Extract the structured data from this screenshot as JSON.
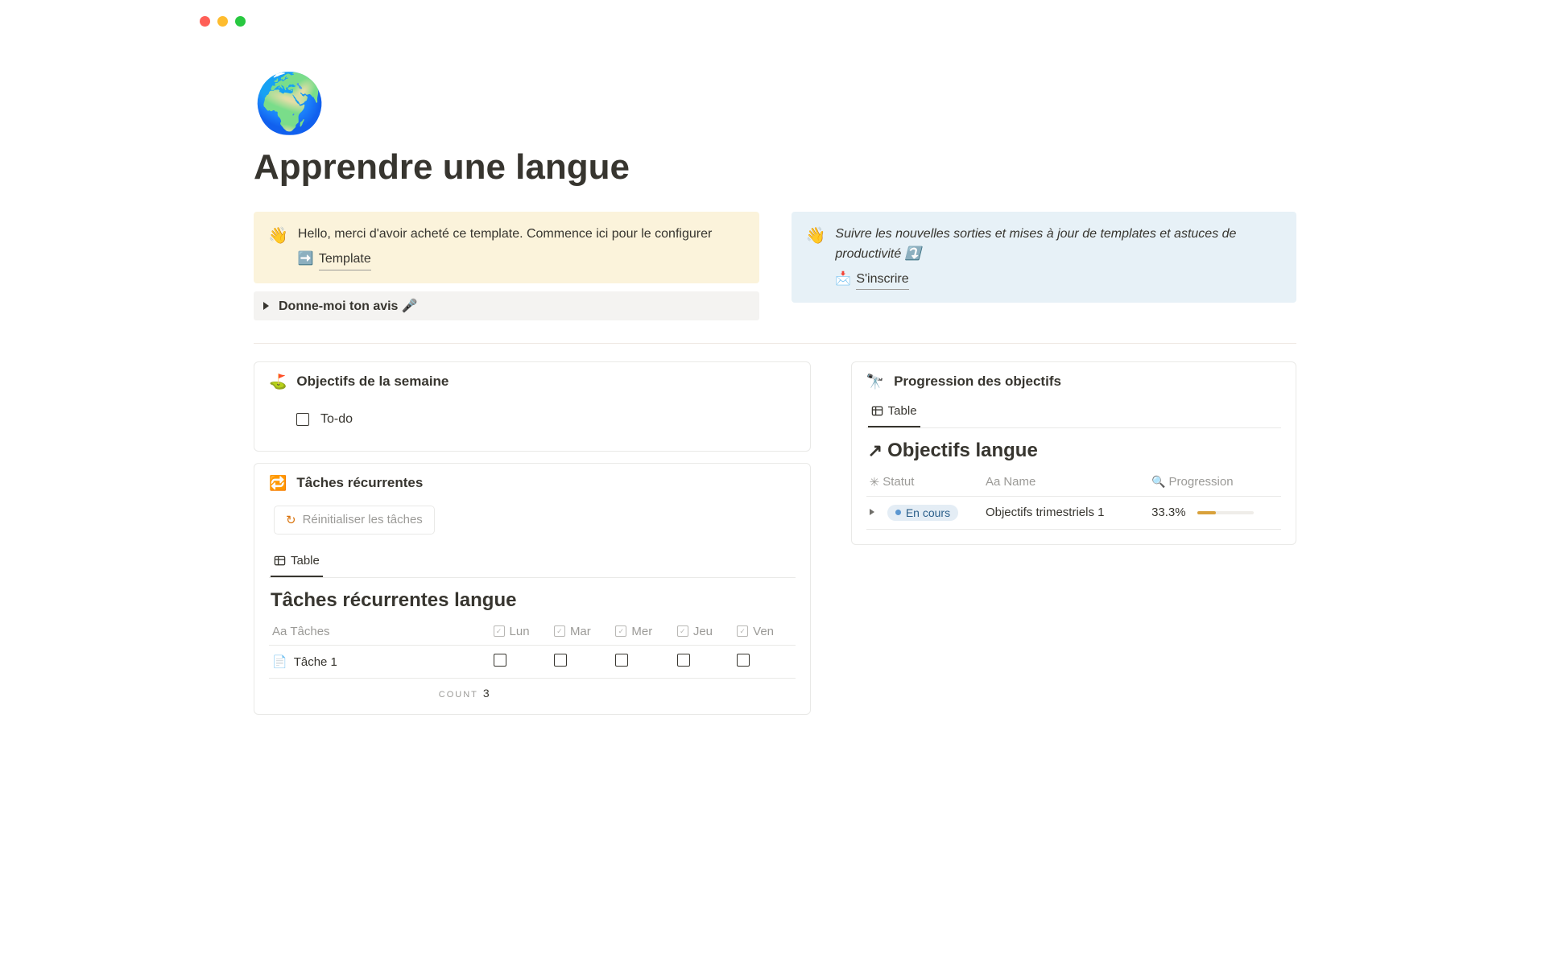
{
  "page": {
    "title": "Apprendre une langue",
    "icon": "🌍"
  },
  "callout_left": {
    "emoji": "👋",
    "text": "Hello, merci d'avoir acheté ce template. Commence ici pour le configurer",
    "link_icon": "➡️",
    "link_text": "Template"
  },
  "callout_right": {
    "emoji": "👋",
    "text": "Suivre les nouvelles sorties et mises à jour de templates et astuces de productivité ⤵️",
    "link_icon": "📩",
    "link_text": "S'inscrire"
  },
  "toggle": {
    "label": "Donne-moi ton avis 🎤"
  },
  "weekly": {
    "icon": "⛳",
    "title": "Objectifs de la semaine",
    "todo_label": "To-do"
  },
  "recurring": {
    "icon": "🔁",
    "title": "Tâches récurrentes",
    "reset_label": "Réinitialiser les tâches",
    "tab_label": "Table",
    "db_title": "Tâches récurrentes langue",
    "columns": {
      "tasks": "Tâches",
      "days": [
        "Lun",
        "Mar",
        "Mer",
        "Jeu",
        "Ven"
      ]
    },
    "row1": "Tâche 1",
    "count_label": "COUNT",
    "count_value": "3"
  },
  "progress": {
    "icon": "🔭",
    "title": "Progression des objectifs",
    "tab_label": "Table",
    "db_title": "Objectifs langue",
    "columns": {
      "status": "Statut",
      "name": "Name",
      "prog": "Progression"
    },
    "row": {
      "status": "En cours",
      "name": "Objectifs trimestriels 1",
      "percent": "33.3%",
      "bar_pct": 33.3
    }
  }
}
